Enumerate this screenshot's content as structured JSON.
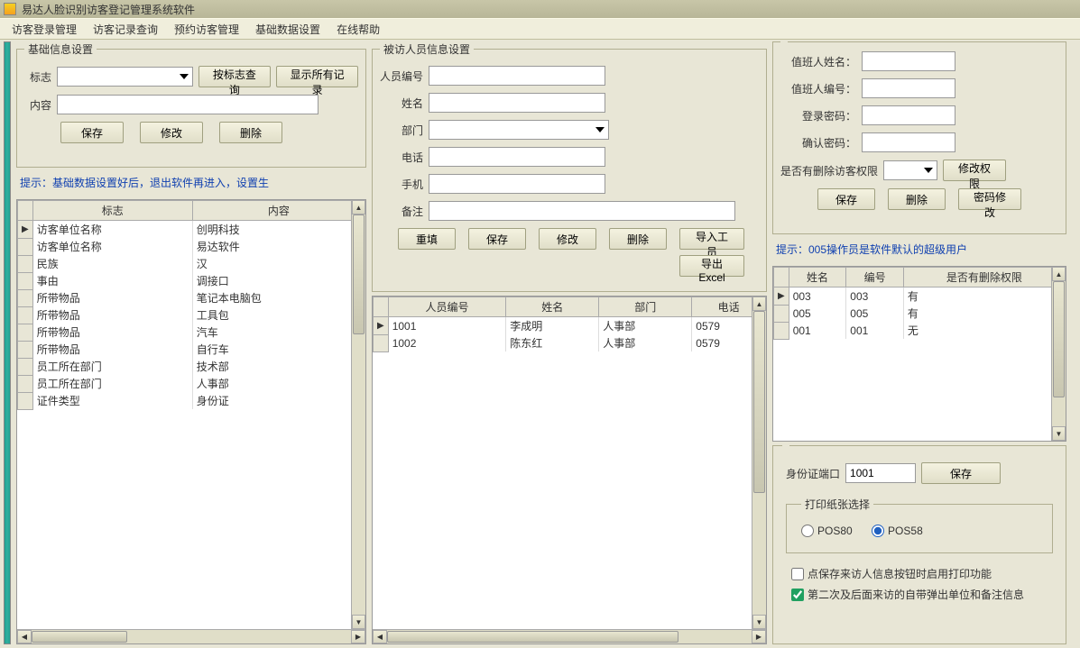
{
  "title": "易达人脸识别访客登记管理系统软件",
  "menu": [
    "访客登录管理",
    "访客记录查询",
    "预约访客管理",
    "基础数据设置",
    "在线帮助"
  ],
  "left": {
    "legend": "基础信息设置",
    "lbl_flag": "标志",
    "btn_searchByFlag": "按标志查询",
    "btn_showAll": "显示所有记录",
    "lbl_content": "内容",
    "btn_save": "保存",
    "btn_edit": "修改",
    "btn_delete": "删除",
    "hint": "提示：基础数据设置好后，退出软件再进入，设置生",
    "cols": [
      "标志",
      "内容"
    ],
    "rows": [
      [
        "访客单位名称",
        "创明科技"
      ],
      [
        "访客单位名称",
        "易达软件"
      ],
      [
        "民族",
        "汉"
      ],
      [
        "事由",
        "调接口"
      ],
      [
        "所带物品",
        "笔记本电脑包"
      ],
      [
        "所带物品",
        "工具包"
      ],
      [
        "所带物品",
        "汽车"
      ],
      [
        "所带物品",
        "自行车"
      ],
      [
        "员工所在部门",
        "技术部"
      ],
      [
        "员工所在部门",
        "人事部"
      ],
      [
        "证件类型",
        "身份证"
      ]
    ]
  },
  "mid": {
    "legend": "被访人员信息设置",
    "lbl_no": "人员编号",
    "lbl_name": "姓名",
    "lbl_dept": "部门",
    "lbl_tel": "电话",
    "lbl_mobile": "手机",
    "lbl_remark": "备注",
    "btn_reset": "重填",
    "btn_save": "保存",
    "btn_edit": "修改",
    "btn_delete": "删除",
    "btn_import": "导入工员",
    "btn_export": "导出Excel",
    "cols": [
      "人员编号",
      "姓名",
      "部门",
      "电话"
    ],
    "rows": [
      [
        "1001",
        "李成明",
        "人事部",
        "0579"
      ],
      [
        "1002",
        "陈东红",
        "人事部",
        "0579"
      ]
    ]
  },
  "right": {
    "lbl_dutyName": "值班人姓名：",
    "lbl_dutyNo": "值班人编号：",
    "lbl_pwd": "登录密码：",
    "lbl_pwd2": "确认密码：",
    "lbl_hasDelPerm": "是否有删除访客权限",
    "btn_editPerm": "修改权限",
    "btn_save": "保存",
    "btn_delete": "删除",
    "btn_pwdEdit": "密码修改",
    "hint": "提示：005操作员是软件默认的超级用户",
    "cols": [
      "姓名",
      "编号",
      "是否有删除权限"
    ],
    "rows": [
      [
        "003",
        "003",
        "有"
      ],
      [
        "005",
        "005",
        "有"
      ],
      [
        "001",
        "001",
        "无"
      ]
    ],
    "lbl_idPort": "身份证端口",
    "val_idPort": "1001",
    "btn_portSave": "保存",
    "legend_paper": "打印纸张选择",
    "opt_pos80": "POS80",
    "opt_pos58": "POS58",
    "chk_print": "点保存来访人信息按钮时启用打印功能",
    "chk_popup": "第二次及后面来访的自带弹出单位和备注信息"
  }
}
